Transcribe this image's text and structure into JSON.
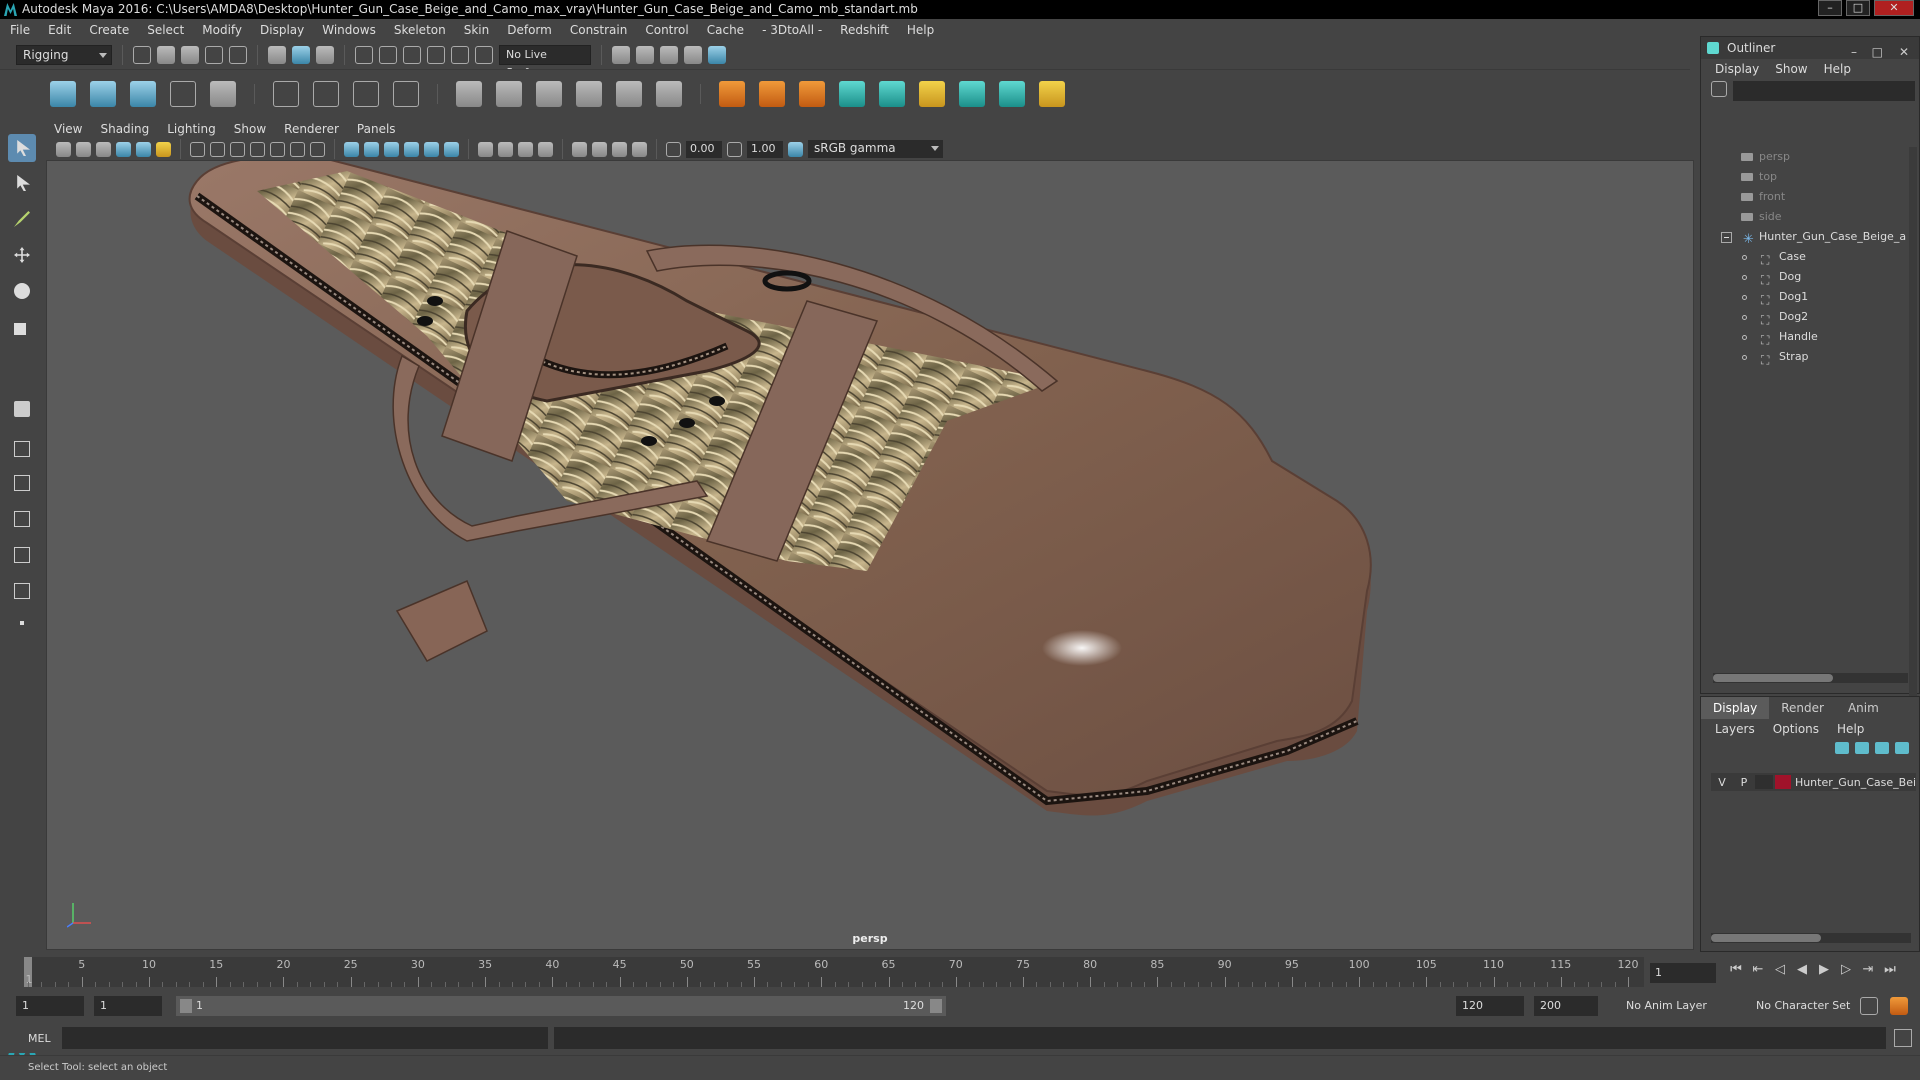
{
  "window": {
    "title": "Autodesk Maya 2016: C:\\Users\\AMDA8\\Desktop\\Hunter_Gun_Case_Beige_and_Camo_max_vray\\Hunter_Gun_Case_Beige_and_Camo_mb_standart.mb"
  },
  "menubar": [
    "File",
    "Edit",
    "Create",
    "Select",
    "Modify",
    "Display",
    "Windows",
    "Skeleton",
    "Skin",
    "Deform",
    "Constrain",
    "Control",
    "Cache",
    "- 3DtoAll -",
    "Redshift",
    "Help"
  ],
  "statusline": {
    "mode": "Rigging",
    "live_surface": "No Live Surface"
  },
  "panel": {
    "menu": [
      "View",
      "Shading",
      "Lighting",
      "Show",
      "Renderer",
      "Panels"
    ],
    "exposure": "0.00",
    "gamma_value": "1.00",
    "color_space": "sRGB gamma",
    "camera": "persp"
  },
  "outliner": {
    "title": "Outliner",
    "menu": [
      "Display",
      "Show",
      "Help"
    ],
    "cameras": [
      "persp",
      "top",
      "front",
      "side"
    ],
    "group": "Hunter_Gun_Case_Beige_a",
    "children": [
      "Case",
      "Dog",
      "Dog1",
      "Dog2",
      "Handle",
      "Strap"
    ]
  },
  "layers": {
    "tabs": [
      "Display",
      "Render",
      "Anim"
    ],
    "menu": [
      "Layers",
      "Options",
      "Help"
    ],
    "row": {
      "v": "V",
      "p": "P",
      "name": "Hunter_Gun_Case_Bei"
    }
  },
  "timeline": {
    "labels": [
      "5",
      "10",
      "15",
      "20",
      "25",
      "30",
      "35",
      "40",
      "45",
      "50",
      "55",
      "60",
      "65",
      "70",
      "75",
      "80",
      "85",
      "90",
      "95",
      "100",
      "105",
      "110",
      "115",
      "120"
    ],
    "start_label": "1",
    "current_frame": "1"
  },
  "range": {
    "start": "1",
    "inner_start": "1",
    "bar_start": "1",
    "bar_end": "120",
    "inner_end": "120",
    "end": "200",
    "anim_layer": "No Anim Layer",
    "character_set": "No Character Set"
  },
  "command": {
    "label": "MEL"
  },
  "help": {
    "text": "Select Tool: select an object"
  },
  "colors": {
    "accent": "#5d8bb0",
    "layer_swatch": "#a0122a",
    "leather": "#8a6a5c"
  }
}
